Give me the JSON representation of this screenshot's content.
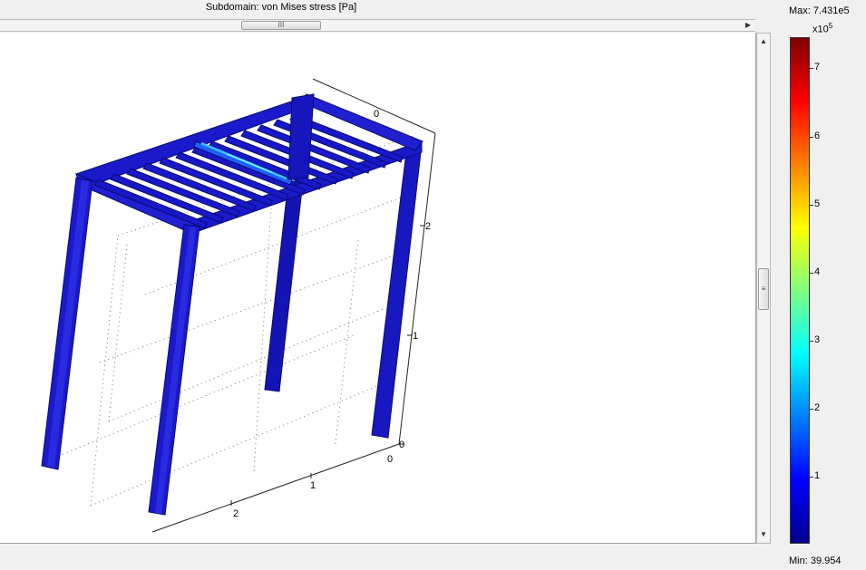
{
  "plot": {
    "title": "Subdomain: von Mises stress [Pa]"
  },
  "scrollbars": {
    "h_thumb_grip": "III",
    "h_right_arrow": "▶",
    "v_up_arrow": "▲",
    "v_down_arrow": "▼",
    "v_thumb_grip": "≡"
  },
  "axes": {
    "z_ticks": [
      "0",
      "1",
      "2",
      "0"
    ],
    "x_ticks": [
      "0",
      "1",
      "2"
    ]
  },
  "colorbar": {
    "max_label": "Max: 7.431e5",
    "multiplier_base": "x10",
    "multiplier_exp": "5",
    "ticks": [
      "7",
      "6",
      "5",
      "4",
      "3",
      "2",
      "1"
    ],
    "min_label": "Min: 39.954",
    "colormap": "jet",
    "range_min": 39.954,
    "range_max": 743100
  },
  "colors": {
    "frame_blue": "#1a1acc",
    "frame_dark": "#0a0a80",
    "frame_highlight": "#3a3af0",
    "stress_cyan": "#40c0ff"
  }
}
